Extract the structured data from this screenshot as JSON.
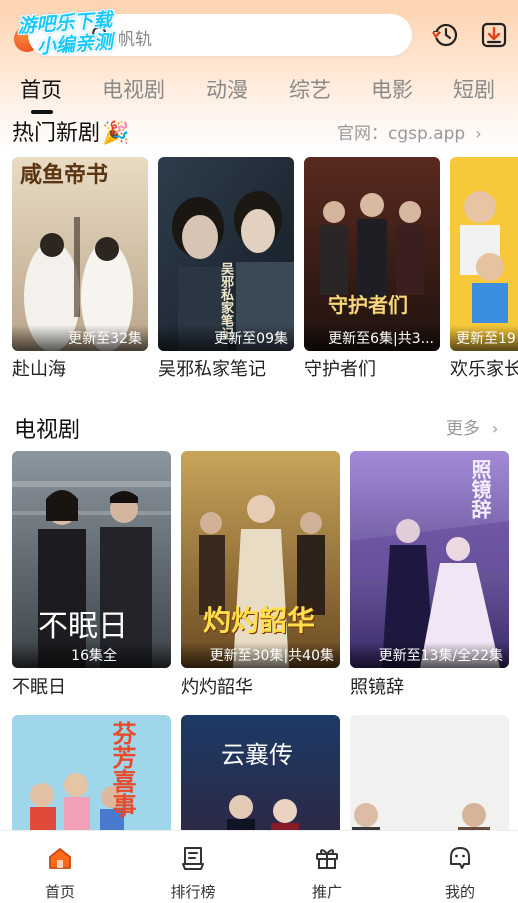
{
  "header": {
    "search_text": "帆轨",
    "watermark_line1": "游吧乐下载",
    "watermark_line2": "小编亲测"
  },
  "tabs": [
    {
      "label": "首页",
      "active": true
    },
    {
      "label": "电视剧"
    },
    {
      "label": "动漫"
    },
    {
      "label": "综艺"
    },
    {
      "label": "电影"
    },
    {
      "label": "短剧"
    }
  ],
  "hot": {
    "title": "热门新剧",
    "official_site": "官网：cgsp.app",
    "items": [
      {
        "title": "赴山海",
        "badge": "更新至32集",
        "poster_text": "咸鱼帝书"
      },
      {
        "title": "吴邪私家笔记",
        "badge": "更新至09集",
        "poster_text": "吴邪私家笔记"
      },
      {
        "title": "守护者们",
        "badge": "更新至6集|共3...",
        "poster_text": "守护者们"
      },
      {
        "title": "欢乐家长",
        "badge": "更新至19",
        "poster_text": ""
      }
    ]
  },
  "tv": {
    "title": "电视剧",
    "more": "更多",
    "items": [
      {
        "title": "不眠日",
        "badge": "16集全",
        "poster_text": "不眠日"
      },
      {
        "title": "灼灼韶华",
        "badge": "更新至30集|共40集",
        "poster_text": "灼灼韶华"
      },
      {
        "title": "照镜辞",
        "badge": "更新至13集/全22集",
        "poster_text": "照镜辞"
      }
    ],
    "row2": [
      {
        "poster_text": "芬芳喜事"
      },
      {
        "poster_text": "云襄传"
      },
      {
        "poster_text": ""
      }
    ]
  },
  "nav": [
    {
      "label": "首页",
      "icon": "home-icon",
      "active": true
    },
    {
      "label": "排行榜",
      "icon": "ranking-icon"
    },
    {
      "label": "推广",
      "icon": "gift-icon"
    },
    {
      "label": "我的",
      "icon": "profile-icon"
    }
  ],
  "colors": {
    "accent": "#ff6a1a",
    "header_gradient_top": "#ffd3b0",
    "watermark": "#1bc9ff"
  }
}
